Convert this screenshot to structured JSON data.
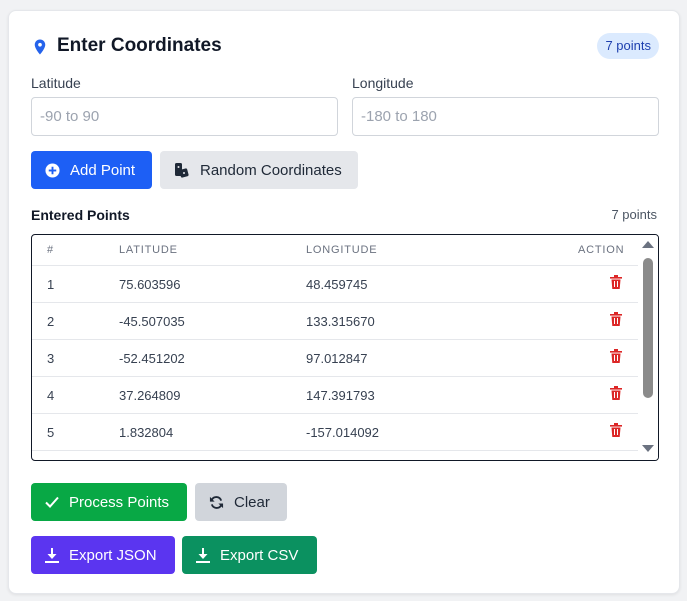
{
  "header": {
    "title": "Enter Coordinates",
    "badge": "7 points"
  },
  "form": {
    "latitude_label": "Latitude",
    "latitude_placeholder": "-90 to 90",
    "latitude_value": "",
    "longitude_label": "Longitude",
    "longitude_placeholder": "-180 to 180",
    "longitude_value": ""
  },
  "buttons": {
    "add_point": "Add Point",
    "random": "Random Coordinates",
    "process": "Process Points",
    "clear": "Clear",
    "export_json": "Export JSON",
    "export_csv": "Export CSV"
  },
  "points_section": {
    "title": "Entered Points",
    "count": "7 points"
  },
  "table": {
    "columns": [
      "#",
      "LATITUDE",
      "LONGITUDE",
      "ACTION"
    ],
    "rows": [
      {
        "index": "1",
        "latitude": "75.603596",
        "longitude": "48.459745"
      },
      {
        "index": "2",
        "latitude": "-45.507035",
        "longitude": "133.315670"
      },
      {
        "index": "3",
        "latitude": "-52.451202",
        "longitude": "97.012847"
      },
      {
        "index": "4",
        "latitude": "37.264809",
        "longitude": "147.391793"
      },
      {
        "index": "5",
        "latitude": "1.832804",
        "longitude": "-157.014092"
      }
    ]
  },
  "colors": {
    "primary": "#1d5ff5",
    "success": "#08a845",
    "danger": "#dc2626",
    "purple": "#5b35f0",
    "teal": "#0b9160"
  },
  "icons": {
    "header": "map-pin-icon",
    "add": "plus-circle-icon",
    "random": "dice-icon",
    "delete": "trash-icon",
    "process": "check-icon",
    "clear": "refresh-icon",
    "export": "download-icon"
  }
}
